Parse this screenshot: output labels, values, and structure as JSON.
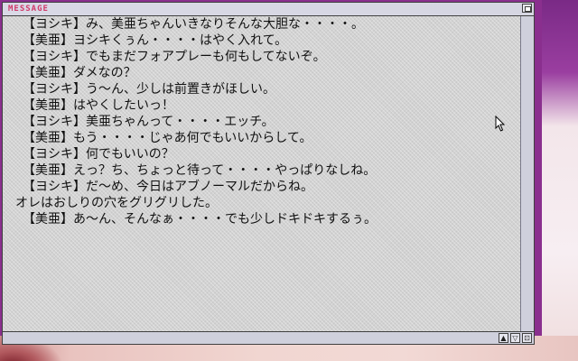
{
  "window": {
    "title": "MESSAGE"
  },
  "messages": [
    "【ヨシキ】み、美亜ちゃんいきなりそんな大胆な・・・・。",
    "【美亜】ヨシキくぅん・・・・はやく入れて。",
    "【ヨシキ】でもまだフォアプレーも何もしてないぞ。",
    "【美亜】ダメなの？",
    "【ヨシキ】う～ん、少しは前置きがほしい。",
    "【美亜】はやくしたいっ！",
    "【ヨシキ】美亜ちゃんって・・・・エッチ。",
    "【美亜】もう・・・・じゃあ何でもいいからして。",
    "【ヨシキ】何でもいいの？",
    "【美亜】えっ？ち、ちょっと待って・・・・やっぱりなしね。",
    "【ヨシキ】だ～め、今日はアブノーマルだからね。",
    "オレはおしりの穴をグリグリした。",
    "【美亜】あ～ん、そんなぁ・・・・でも少しドキドキするぅ。"
  ],
  "controls": {
    "scroll_up": "▲",
    "scroll_down": "▽",
    "resize": "⊡"
  },
  "icons": {
    "close": "close-box-icon",
    "cursor": "mouse-pointer-icon"
  },
  "colors": {
    "title_text": "#d03a6a",
    "background_purple": "#8a2f8e"
  }
}
